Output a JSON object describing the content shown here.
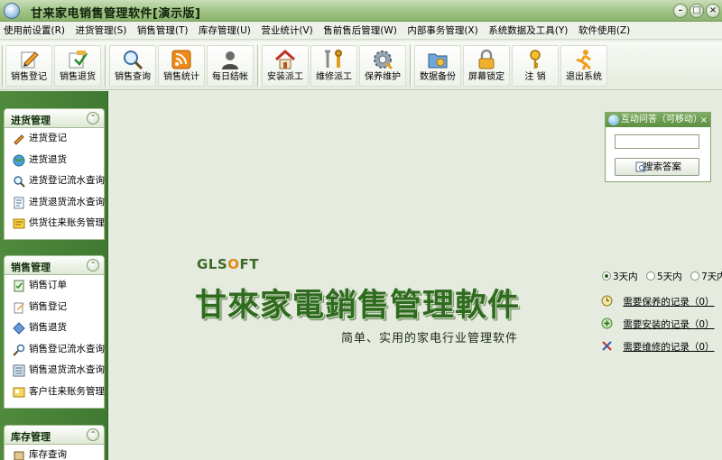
{
  "window": {
    "title": "甘来家电销售管理软件[演示版]",
    "minimize": "–",
    "maximize": "□",
    "close": "×"
  },
  "menu": [
    "使用前设置(R)",
    "进货管理(S)",
    "销售管理(T)",
    "库存管理(U)",
    "营业统计(V)",
    "售前售后管理(W)",
    "内部事务管理(X)",
    "系统数据及工具(Y)",
    "软件使用(Z)"
  ],
  "toolbar": [
    {
      "label": "销售登记",
      "icon": "pencil-paper-icon"
    },
    {
      "label": "销售退货",
      "icon": "paper-return-icon"
    },
    {
      "label": "销售查询",
      "icon": "magnifier-icon"
    },
    {
      "label": "销售统计",
      "icon": "rss-chart-icon"
    },
    {
      "label": "每日结帐",
      "icon": "person-icon"
    },
    {
      "label": "安装派工",
      "icon": "house-icon"
    },
    {
      "label": "维修派工",
      "icon": "wrench-icon"
    },
    {
      "label": "保养维护",
      "icon": "gear-icon"
    },
    {
      "label": "数据备份",
      "icon": "folder-icon"
    },
    {
      "label": "屏幕锁定",
      "icon": "lock-icon"
    },
    {
      "label": "注 销",
      "icon": "key-icon"
    },
    {
      "label": "退出系统",
      "icon": "running-man-icon"
    }
  ],
  "sidebar": {
    "panels": [
      {
        "title": "进货管理",
        "items": [
          "进货登记",
          "进货退货",
          "进货登记流水查询",
          "进货退货流水查询",
          "供货往来账务管理"
        ]
      },
      {
        "title": "销售管理",
        "items": [
          "销售订单",
          "销售登记",
          "销售退货",
          "销售登记流水查询",
          "销售退货流水查询",
          "客户往来账务管理"
        ]
      },
      {
        "title": "库存管理",
        "items": [
          "库存查询"
        ]
      }
    ]
  },
  "qa_panel": {
    "title": "互动问答（可移动）",
    "close": "×",
    "input_value": "",
    "button": "搜索答案"
  },
  "logo": {
    "brand": "GLSOFT",
    "title": "甘來家電銷售管理軟件",
    "slogan": "简单、实用的家电行业管理软件"
  },
  "days": {
    "options": [
      "3天内",
      "5天内",
      "7天内"
    ],
    "selected": "3天内"
  },
  "records": [
    {
      "label": "需要保养的记录（0）",
      "icon": "clock-icon"
    },
    {
      "label": "需要安装的记录（0）",
      "icon": "plus-icon"
    },
    {
      "label": "需要维修的记录（0）",
      "icon": "tools-icon"
    }
  ],
  "colors": {
    "accent": "#3f7a31",
    "title_green": "#2f6b1f",
    "bg": "#e6ebe0"
  }
}
